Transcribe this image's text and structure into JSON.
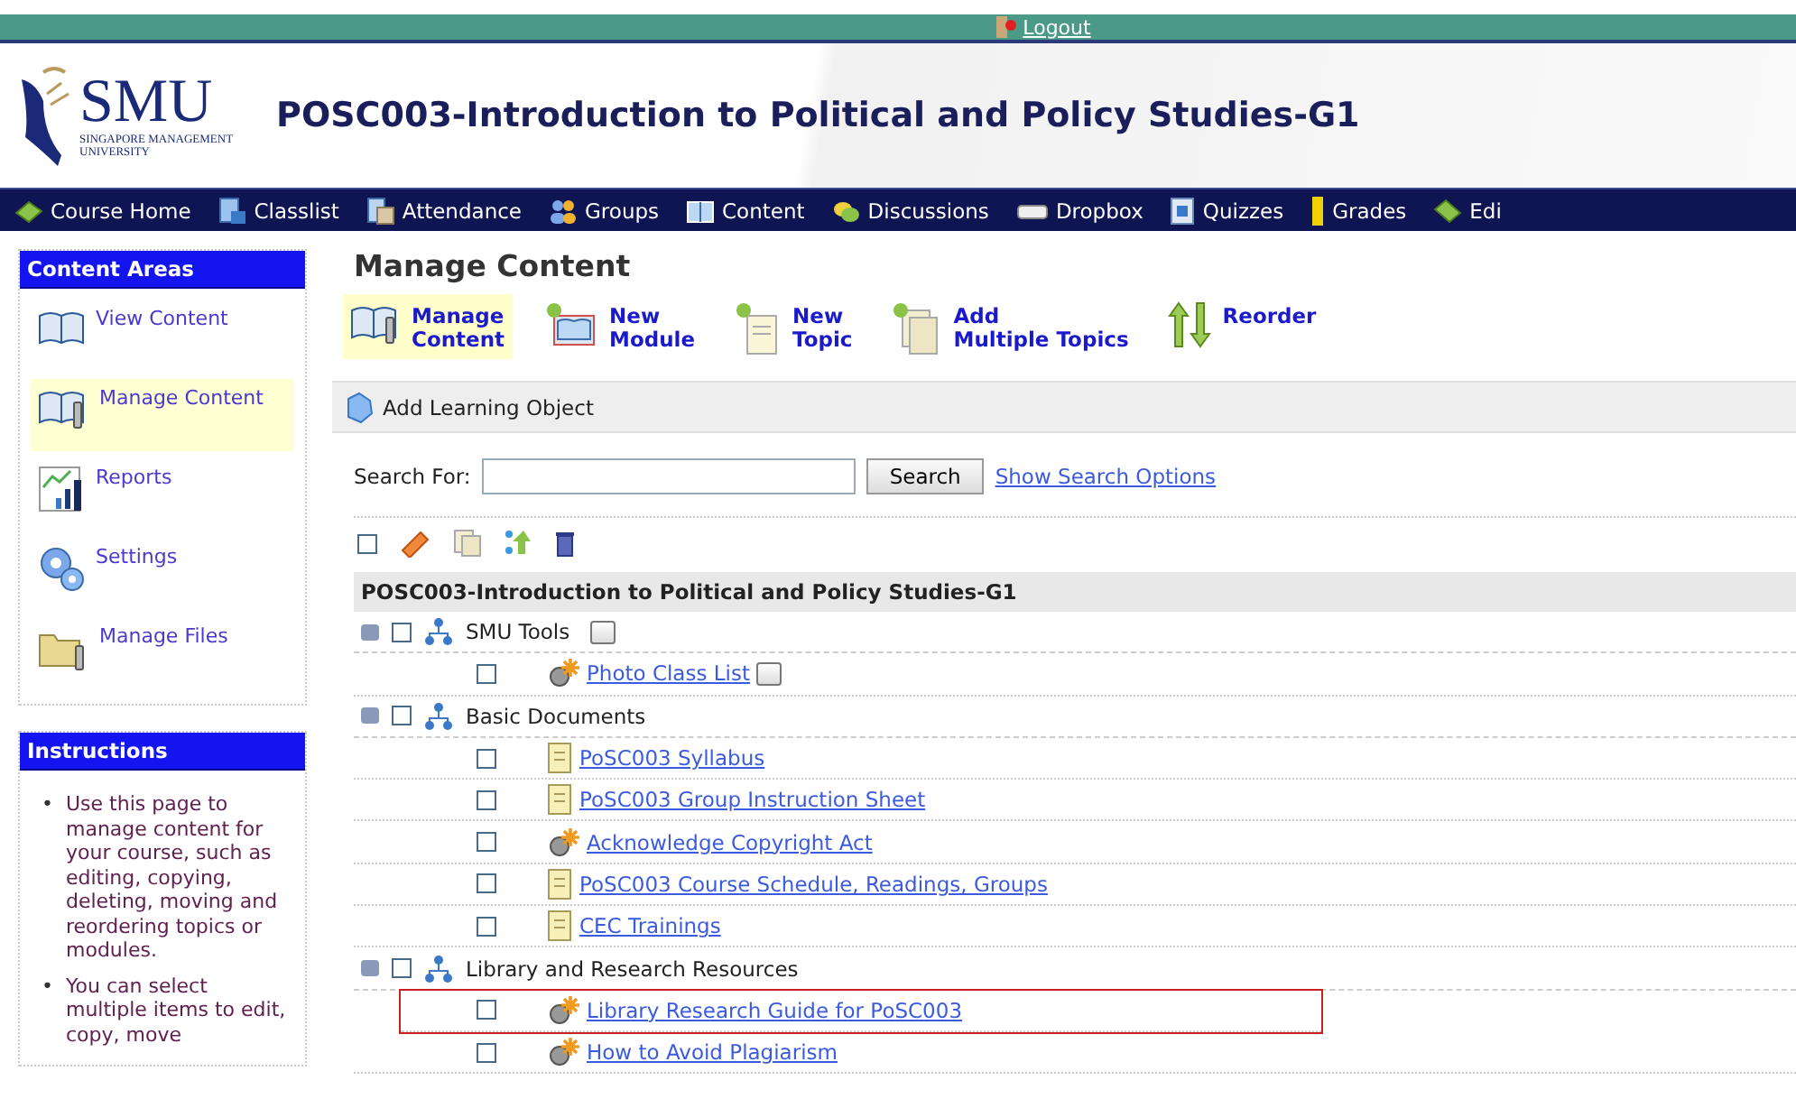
{
  "top_bar": {
    "logout": "Logout"
  },
  "logo": {
    "name": "SMU",
    "subtitle": "SINGAPORE MANAGEMENT",
    "subtitle_2": "UNIVERSITY"
  },
  "course_title": "POSC003-Introduction to Political and Policy Studies-G1",
  "nav": [
    {
      "label": "Course Home"
    },
    {
      "label": "Classlist"
    },
    {
      "label": "Attendance"
    },
    {
      "label": "Groups"
    },
    {
      "label": "Content"
    },
    {
      "label": "Discussions"
    },
    {
      "label": "Dropbox"
    },
    {
      "label": "Quizzes"
    },
    {
      "label": "Grades"
    },
    {
      "label": "Edi"
    }
  ],
  "sidebar": {
    "content_areas": {
      "title": "Content Areas",
      "items": [
        {
          "label": "View Content",
          "selected": false
        },
        {
          "label": "Manage Content",
          "selected": true
        },
        {
          "label": "Reports",
          "selected": false
        },
        {
          "label": "Settings",
          "selected": false
        },
        {
          "label": "Manage Files",
          "selected": false
        }
      ]
    },
    "instructions": {
      "title": "Instructions",
      "items": [
        {
          "bullet": "•",
          "text": "Use this page to manage content for your course, such as editing, copying, deleting, moving and reordering topics or modules."
        },
        {
          "bullet": "•",
          "text": "You can select multiple items to edit, copy, move"
        }
      ]
    }
  },
  "main": {
    "title": "Manage Content",
    "toolbar": [
      {
        "lines": [
          "Manage",
          "Content"
        ],
        "selected": true
      },
      {
        "lines": [
          "New",
          "Module"
        ],
        "selected": false
      },
      {
        "lines": [
          "New",
          "Topic"
        ],
        "selected": false
      },
      {
        "lines": [
          "Add",
          "Multiple Topics"
        ],
        "selected": false
      },
      {
        "lines": [
          "Reorder"
        ],
        "selected": false
      }
    ],
    "add_learning_object": "Add Learning Object",
    "search": {
      "label": "Search For:",
      "button": "Search",
      "options_link": "Show Search Options"
    },
    "select_all": {
      "checked": false
    },
    "course_heading": "POSC003-Introduction to Political and Policy Studies-G1",
    "modules": [
      {
        "label": "SMU Tools",
        "expanded": true,
        "checked": false,
        "menu_button": true,
        "children": [
          {
            "label": "Photo Class List",
            "kind": "tool",
            "checked": false,
            "menu_button": true,
            "highlighted": false
          }
        ]
      },
      {
        "label": "Basic Documents",
        "expanded": true,
        "checked": false,
        "menu_button": false,
        "children": [
          {
            "label": "PoSC003 Syllabus",
            "kind": "file",
            "checked": false,
            "menu_button": false,
            "highlighted": false
          },
          {
            "label": "PoSC003 Group Instruction Sheet",
            "kind": "file",
            "checked": false,
            "menu_button": false,
            "highlighted": false
          },
          {
            "label": "Acknowledge Copyright Act",
            "kind": "tool",
            "checked": false,
            "menu_button": false,
            "highlighted": false
          },
          {
            "label": "PoSC003 Course Schedule, Readings, Groups",
            "kind": "file",
            "checked": false,
            "menu_button": false,
            "highlighted": false
          },
          {
            "label": "CEC Trainings",
            "kind": "file",
            "checked": false,
            "menu_button": false,
            "highlighted": false
          }
        ]
      },
      {
        "label": "Library and Research Resources",
        "expanded": true,
        "checked": false,
        "menu_button": false,
        "children": [
          {
            "label": "Library Research Guide for PoSC003",
            "kind": "tool",
            "checked": false,
            "menu_button": false,
            "highlighted": true
          },
          {
            "label": "How to Avoid Plagiarism",
            "kind": "tool",
            "checked": false,
            "menu_button": false,
            "highlighted": false
          }
        ]
      }
    ]
  }
}
